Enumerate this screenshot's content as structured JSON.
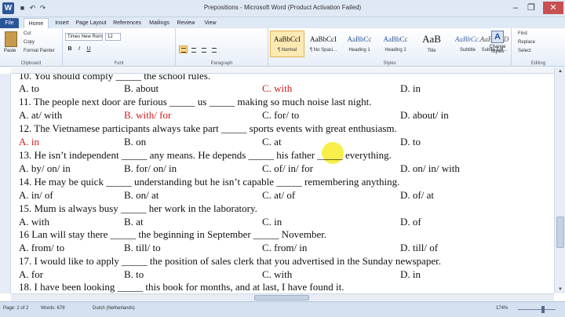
{
  "window": {
    "title": "Prepositions - Microsoft Word (Product Activation Failed)",
    "logo": "W",
    "minimize": "–",
    "maximize": "❐",
    "close": "✕"
  },
  "qat": {
    "save": "■",
    "undo": "↶",
    "redo": "↷"
  },
  "tabs": [
    "File",
    "Home",
    "Insert",
    "Page Layout",
    "References",
    "Mailings",
    "Review",
    "View"
  ],
  "ribbon": {
    "clipboard": {
      "paste": "Paste",
      "cut": "Cut",
      "copy": "Copy",
      "format_painter": "Format Painter",
      "label": "Clipboard"
    },
    "font": {
      "font_name": "Times New Rom",
      "font_size": "12",
      "label": "Font",
      "bold": "B",
      "italic": "I",
      "underline": "U"
    },
    "paragraph": {
      "label": "Paragraph"
    },
    "styles": {
      "label": "Styles",
      "items": [
        {
          "sample": "AaBbCcI",
          "name": "¶ Normal"
        },
        {
          "sample": "AaBbCcI",
          "name": "¶ No Spaci..."
        },
        {
          "sample": "AaBbCc",
          "name": "Heading 1"
        },
        {
          "sample": "AaBbCc",
          "name": "Heading 2"
        },
        {
          "sample": "AaB",
          "name": "Title"
        },
        {
          "sample": "AaBbCc.",
          "name": "Subtitle"
        },
        {
          "sample": "AaBbCcD",
          "name": "Subtle Em..."
        }
      ],
      "change_styles": "Change Styles",
      "change_styles_icon": "A"
    },
    "editing": {
      "find": "Find",
      "replace": "Replace",
      "select": "Select",
      "label": "Editing"
    }
  },
  "document": {
    "lines": [
      {
        "q": "10. You should comply _____ the school rules.",
        "a": "A. to",
        "b": "B. about",
        "c": "C. with",
        "d": "D. in",
        "red": "c"
      },
      {
        "q": "11. The people next door are furious _____ us _____ making so much noise last night.",
        "a": "A. at/ with",
        "b": "B. with/ for",
        "c": "C. for/ to",
        "d": "D. about/ in",
        "red": "b"
      },
      {
        "q": "12. The Vietnamese participants always take part _____ sports events with great enthusiasm.",
        "a": "A. in",
        "b": "B. on",
        "c": "C. at",
        "d": "D. to",
        "red": "a"
      },
      {
        "q": "13. He isn’t independent _____ any means. He depends _____ his father _____ everything.",
        "a": "A. by/ on/ in",
        "b": "B. for/ on/ in",
        "c": "C. of/ in/ for",
        "d": "D. on/ in/ with",
        "red": ""
      },
      {
        "q": "14. He may be quick _____ understanding but he isn’t capable _____ remembering anything.",
        "a": "A. in/ of",
        "b": "B. on/ at",
        "c": "C. at/ of",
        "d": "D. of/ at",
        "red": ""
      },
      {
        "q": "15. Mum is always busy _____ her work in the laboratory.",
        "a": "A. with",
        "b": "B. at",
        "c": "C. in",
        "d": "D. of",
        "red": ""
      },
      {
        "q": "16 Lan will stay there _____ the beginning in September _____ November.",
        "a": "A. from/ to",
        "b": "B. till/ to",
        "c": "C. from/ in",
        "d": "D. till/ of",
        "red": ""
      },
      {
        "q": "17. I would like to apply _____ the position of sales clerk that you advertised in the Sunday newspaper.",
        "a": "A. for",
        "b": "B. to",
        "c": "C. with",
        "d": "D. in",
        "red": ""
      },
      {
        "q": "18. I have been looking _____ this book for months, and at last, I have found it.",
        "a": "",
        "b": "",
        "c": "",
        "d": "",
        "red": ""
      }
    ]
  },
  "status": {
    "page": "Page: 2 of 2",
    "words": "Words: 678",
    "language": "Dutch (Netherlands)",
    "zoom": "174%"
  }
}
